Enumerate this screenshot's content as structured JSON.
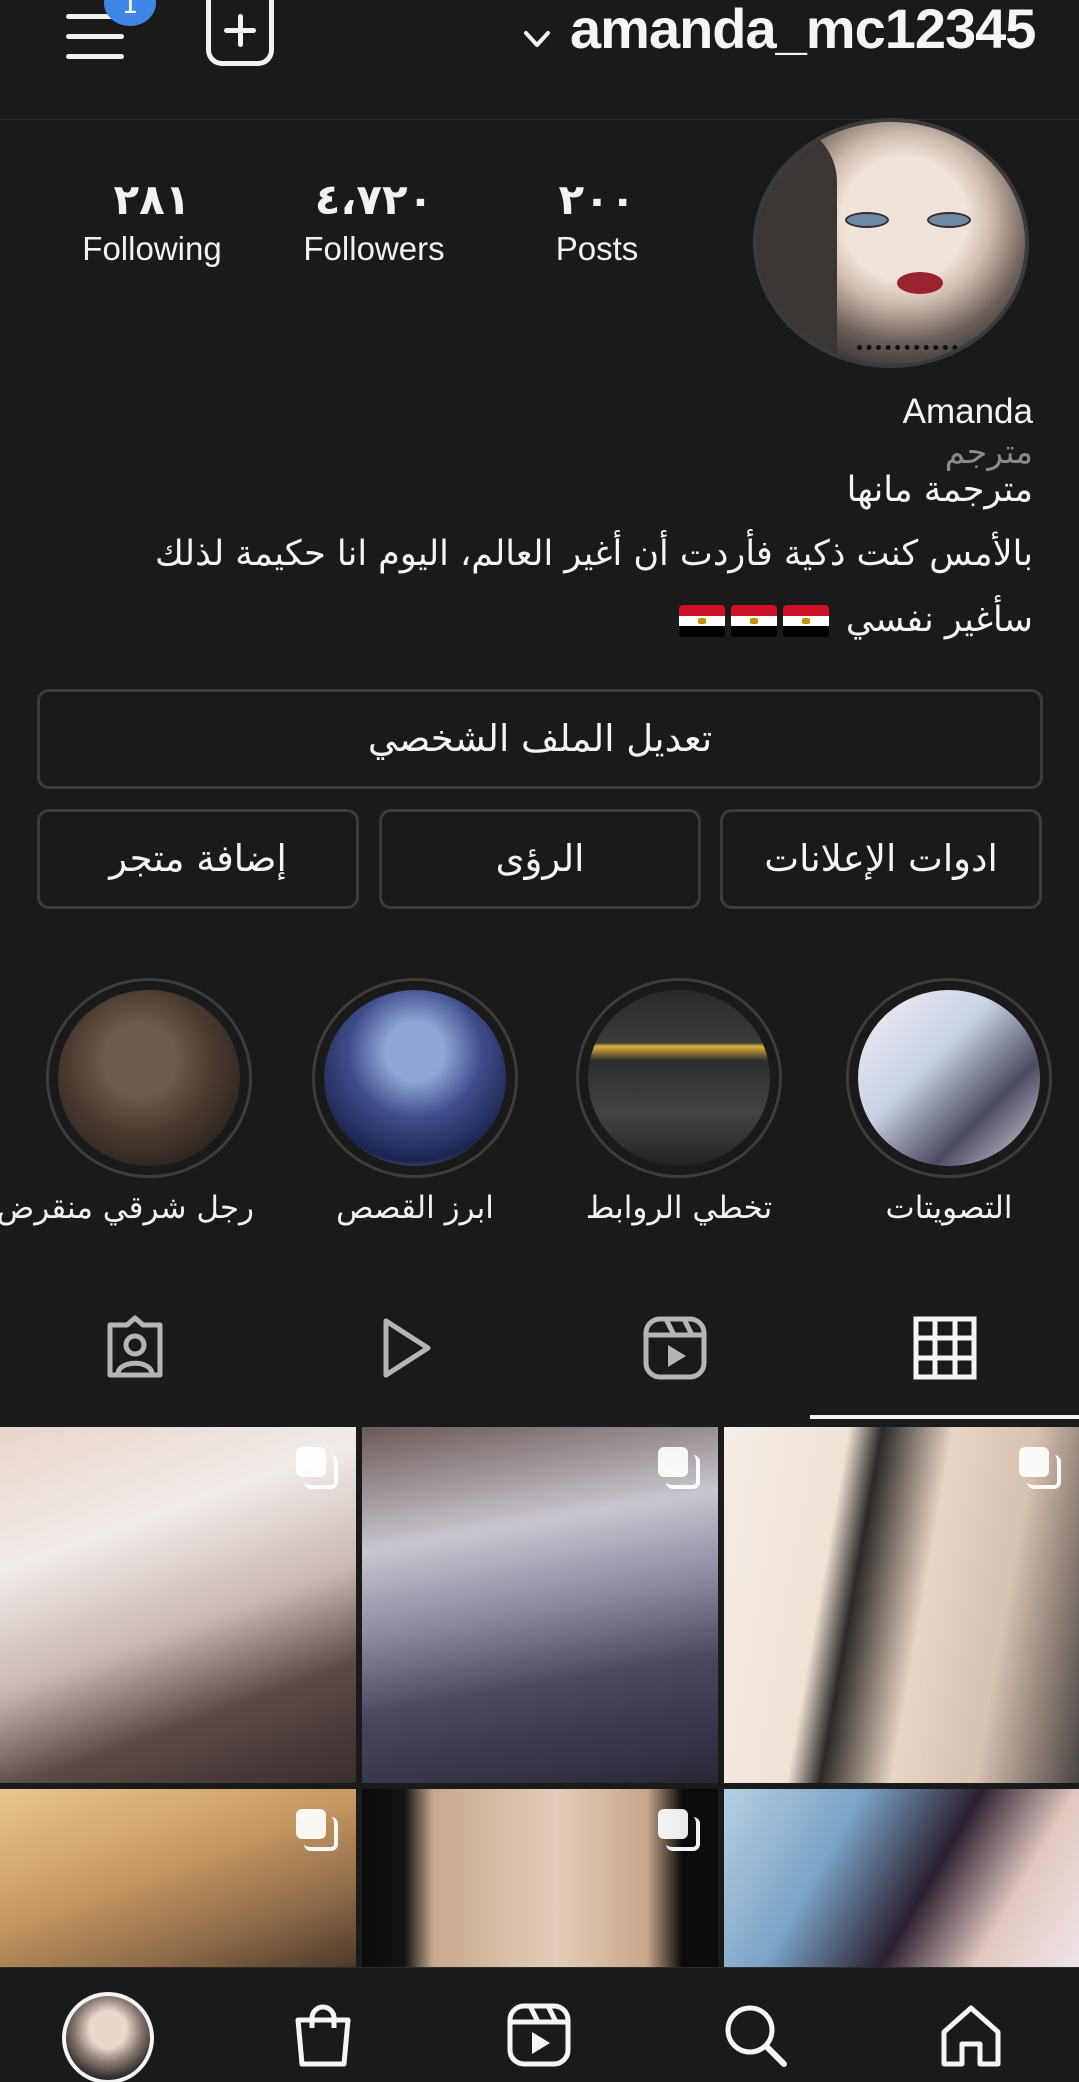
{
  "topbar": {
    "username": "amanda_mc12345",
    "notification_count": "1",
    "icons": [
      "menu-icon",
      "plus-square-icon",
      "chevron-down-icon"
    ]
  },
  "stats": {
    "following": {
      "value": "٢٨١",
      "label": "Following"
    },
    "followers": {
      "value": "٤،٧٢٠",
      "label": "Followers"
    },
    "posts": {
      "value": "٢٠٠",
      "label": "Posts"
    }
  },
  "bio": {
    "name": "Amanda",
    "category": "مترجم",
    "line1": "مترجمة مانها",
    "line2": "بالأمس كنت ذكية فأردت أن أغير العالم، اليوم انا حكيمة لذلك",
    "line3": "سأغير نفسي"
  },
  "buttons": {
    "edit_profile": "تعديل الملف الشخصي",
    "ad_tools": "ادوات الإعلانات",
    "insights": "الرؤى",
    "add_shop": "إضافة متجر"
  },
  "highlights": [
    {
      "label": "التصويتات",
      "icon": "highlight-cover"
    },
    {
      "label": "تخطي الروابط",
      "icon": "highlight-cover"
    },
    {
      "label": "ابرز القصص",
      "icon": "highlight-cover"
    },
    {
      "label": "رجل شرقي منقرض",
      "icon": "highlight-cover"
    }
  ],
  "tabs": [
    {
      "name": "grid",
      "icon": "grid-icon",
      "active": true
    },
    {
      "name": "reels",
      "icon": "reels-icon",
      "active": false
    },
    {
      "name": "videos",
      "icon": "play-icon",
      "active": false
    },
    {
      "name": "tagged",
      "icon": "tagged-person-icon",
      "active": false
    }
  ],
  "posts": [
    {
      "multi": true,
      "icon": "carousel-icon"
    },
    {
      "multi": true,
      "icon": "carousel-icon"
    },
    {
      "multi": true,
      "icon": "carousel-icon"
    },
    {
      "multi": true,
      "icon": "carousel-icon"
    },
    {
      "multi": true,
      "icon": "carousel-icon"
    },
    {
      "multi": false
    }
  ],
  "bottom_nav": [
    "profile-avatar",
    "shop-icon",
    "reels-icon",
    "search-icon",
    "home-icon"
  ],
  "colors": {
    "background": "#1a1a1a",
    "text": "#f5f5f5",
    "muted": "#8a8a8a",
    "border": "#3c3c3c",
    "badge": "#3f86e6"
  }
}
